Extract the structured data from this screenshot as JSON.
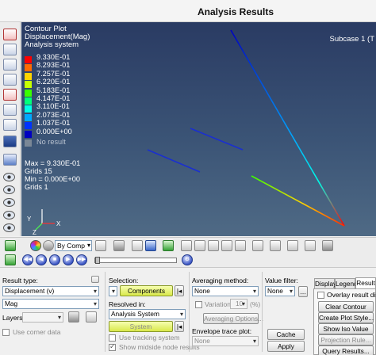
{
  "window": {
    "title": "Analysis Results"
  },
  "viewport": {
    "contour_title": "Contour Plot",
    "result_type": "Displacement(Mag)",
    "system": "Analysis system",
    "subcase": "Subcase 1 (T",
    "legend": {
      "entries": [
        {
          "value": "9.330E-01",
          "color": "#ff0000"
        },
        {
          "value": "8.293E-01",
          "color": "#ff6a00"
        },
        {
          "value": "7.257E-01",
          "color": "#ffd400"
        },
        {
          "value": "6.220E-01",
          "color": "#c6ff00"
        },
        {
          "value": "5.183E-01",
          "color": "#39ff00"
        },
        {
          "value": "4.147E-01",
          "color": "#00ff7a"
        },
        {
          "value": "3.110E-01",
          "color": "#00ffe6"
        },
        {
          "value": "2.073E-01",
          "color": "#00a8ff"
        },
        {
          "value": "1.037E-01",
          "color": "#0033ff"
        },
        {
          "value": "0.000E+00",
          "color": "#0000c0"
        }
      ],
      "no_result": "No result"
    },
    "stats": {
      "max": "Max = 9.330E-01",
      "max_grids": "Grids 15",
      "min": "Min = 0.000E+00",
      "min_grids": "Grids 1"
    },
    "triad": {
      "x": "X",
      "y": "Y",
      "z": "Z"
    }
  },
  "toolbar": {
    "by_comp": "By Comp"
  },
  "panel": {
    "result_type_label": "Result type:",
    "result_type_value": "Displacement (v)",
    "component_value": "Mag",
    "layers_label": "Layers:",
    "use_corner_data": "Use corner data",
    "selection_label": "Selection:",
    "components_btn": "Components",
    "resolved_in_label": "Resolved in:",
    "resolved_in_value": "Analysis System",
    "system_btn": "System",
    "use_tracking_system": "Use tracking system",
    "show_midside": "Show midside node results",
    "averaging_method_label": "Averaging method:",
    "averaging_method_value": "None",
    "variation_label": "Variation <",
    "variation_value": "10",
    "variation_unit": "(%)",
    "averaging_options_btn": "Averaging Options...",
    "envelope_label": "Envelope trace plot:",
    "envelope_value": "None",
    "value_filter_label": "Value filter:",
    "value_filter_value": "None",
    "cache_btn": "Cache",
    "apply_btn": "Apply",
    "tabs": [
      "Display",
      "Legend",
      "Result"
    ],
    "overlay_result_display": "Overlay result display",
    "clear_contour_btn": "Clear Contour",
    "create_plot_style_btn": "Create Plot Style...",
    "show_iso_value_btn": "Show Iso Value",
    "projection_rule_btn": "Projection Rule...",
    "query_results_btn": "Query Results..."
  }
}
